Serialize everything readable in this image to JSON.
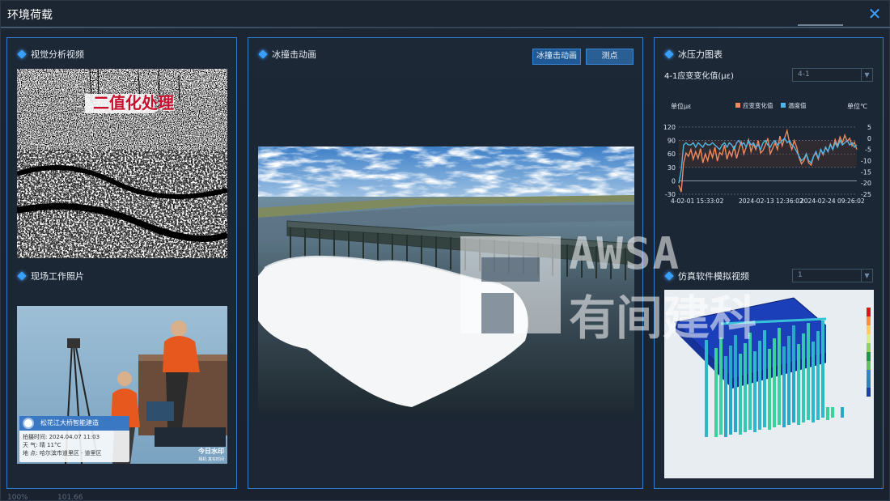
{
  "window": {
    "title": "环境荷载",
    "close_icon": "close-icon"
  },
  "left_panel": {
    "video_section": {
      "title": "视觉分析视频",
      "overlay_text": "二值化处理"
    },
    "photo_section": {
      "title": "现场工作照片",
      "stamp": {
        "project": "松花江大桥智能建造",
        "time_label": "拍摄时间:",
        "time_value": "2024.04.07 11:03",
        "weather_label": "天 气:",
        "weather_value": "晴 11°C",
        "location_label": "地 点:",
        "location_value": "哈尔滨市道里区 · 道里区"
      },
      "logo_text": "今日水印",
      "logo_sub": "相机 真实时间"
    }
  },
  "middle_panel": {
    "title": "冰撞击动画",
    "buttons": {
      "animation": "冰撞击动画",
      "points": "测点"
    }
  },
  "right_panel": {
    "chart_section": {
      "title": "冰压力图表",
      "metric_label": "4-1应变变化值(με)",
      "select_value": "4-1"
    },
    "sim_section": {
      "title": "仿真软件模拟视频",
      "select_value": "1"
    }
  },
  "chart_data": {
    "type": "line",
    "ylabel_left": "单位με",
    "ylabel_right": "单位℃",
    "y_left_ticks": [
      120,
      90,
      60,
      30,
      0,
      -30
    ],
    "y_right_ticks": [
      5,
      0,
      -5,
      -10,
      -15,
      -20,
      -25
    ],
    "ylim_left": [
      -30,
      120
    ],
    "ylim_right": [
      -25,
      5
    ],
    "x_tick_labels": [
      "4-02-01 15:33:02",
      "2024-02-13 12:36:02",
      "2024-02-24 09:26:02"
    ],
    "legend_position": "top",
    "series": [
      {
        "name": "应变变化值",
        "color": "#f08a5d",
        "axis": "left",
        "values": [
          -10,
          -25,
          40,
          62,
          55,
          70,
          48,
          65,
          50,
          72,
          40,
          60,
          45,
          68,
          52,
          75,
          44,
          63,
          58,
          80,
          48,
          66,
          55,
          78,
          50,
          70,
          88,
          60,
          75,
          92,
          65,
          82,
          70,
          90,
          62,
          68,
          80,
          95,
          60,
          72,
          85,
          70,
          100,
          78,
          96,
          112,
          85,
          70,
          90,
          75,
          52,
          38,
          45,
          60,
          40,
          35,
          55,
          62,
          48,
          70,
          58,
          75,
          65,
          82,
          70,
          92,
          78,
          98,
          85,
          102,
          88,
          95,
          78,
          86,
          70
        ]
      },
      {
        "name": "温度值",
        "color": "#4ab7e8",
        "axis": "right",
        "values": [
          -20,
          -14,
          -3,
          -2,
          -3,
          -3,
          -2,
          -4,
          -2,
          -3,
          -4,
          -2,
          -3,
          -3,
          -2,
          -3,
          -4,
          -5,
          -3,
          -2,
          -4,
          -2,
          -3,
          -5,
          -2,
          -1,
          -3,
          -2,
          -4,
          -1,
          -3,
          -2,
          -4,
          -3,
          -5,
          -2,
          -1,
          -3,
          -4,
          -2,
          -1,
          -3,
          -2,
          -1,
          0,
          -2,
          -1,
          -3,
          -4,
          -6,
          -8,
          -10,
          -9,
          -7,
          -10,
          -11,
          -8,
          -6,
          -9,
          -5,
          -7,
          -4,
          -6,
          -3,
          -5,
          -2,
          -4,
          -1,
          -3,
          -2,
          -1,
          -3,
          -2,
          -4,
          -3
        ]
      }
    ]
  },
  "watermark": {
    "brand": "AWSA",
    "text": "有间建科"
  },
  "status": {
    "zoom": "100%",
    "value": "101.66"
  },
  "colors": {
    "accent": "#2f7fd1",
    "panel_border": "#2f7fd1",
    "diamond": "#3aa0ff"
  }
}
